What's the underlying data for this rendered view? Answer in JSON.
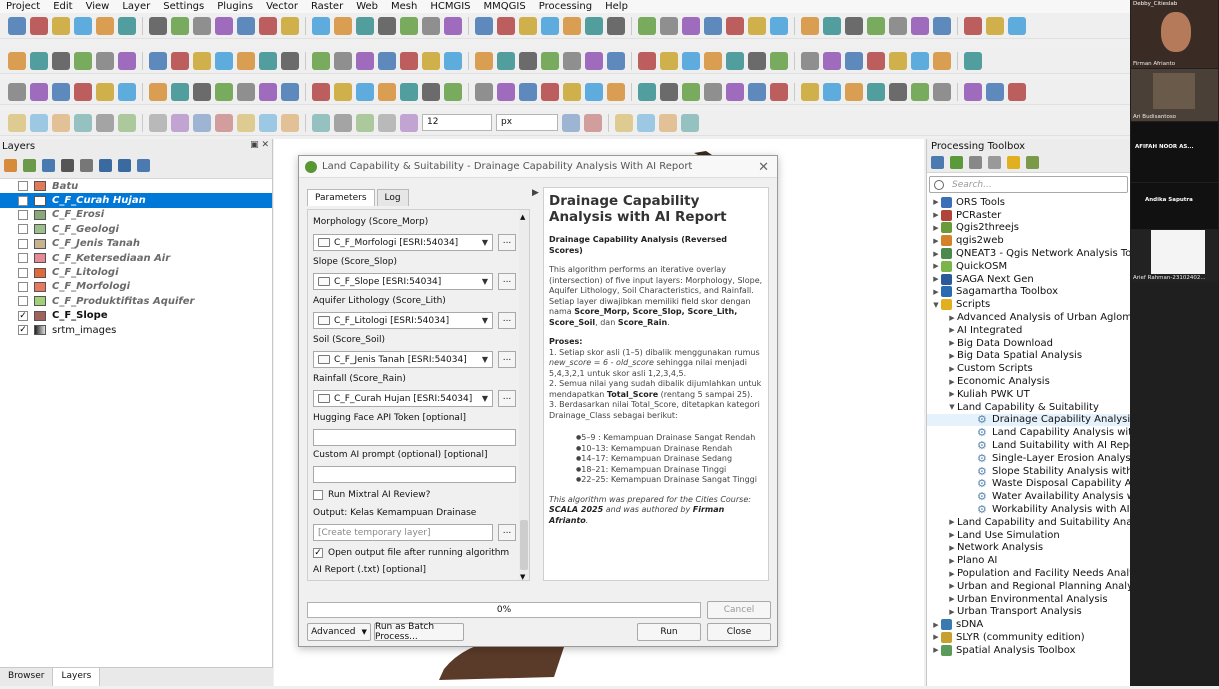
{
  "menu": [
    "Project",
    "Edit",
    "View",
    "Layer",
    "Settings",
    "Plugins",
    "Vector",
    "Raster",
    "Web",
    "Mesh",
    "HCMGIS",
    "MMQGIS",
    "Processing",
    "Help"
  ],
  "toolbar": {
    "size_value": "12",
    "unit_value": "px"
  },
  "layers_panel": {
    "title": "Layers",
    "items": [
      {
        "name": "Batu",
        "color": "#e27a5a",
        "checked": false
      },
      {
        "name": "C_F_Curah Hujan",
        "color": "#ffffff",
        "checked": false
      },
      {
        "name": "C_F_Erosi",
        "color": "#8aa87a",
        "checked": false
      },
      {
        "name": "C_F_Geologi",
        "color": "#9abf8a",
        "checked": false
      },
      {
        "name": "C_F_Jenis Tanah",
        "color": "#c7b48f",
        "checked": false
      },
      {
        "name": "C_F_Ketersediaan Air",
        "color": "#e88a95",
        "checked": false
      },
      {
        "name": "C_F_Litologi",
        "color": "#e2693a",
        "checked": false
      },
      {
        "name": "C_F_Morfologi",
        "color": "#e8785f",
        "checked": false
      },
      {
        "name": "C_F_Produktifitas Aquifer",
        "color": "#a4cf7a",
        "checked": false
      },
      {
        "name": "C_F_Slope",
        "color": "#a0625a",
        "checked": true
      },
      {
        "name": "srtm_images",
        "color": "",
        "checked": true
      }
    ],
    "bottom_tabs": [
      "Browser",
      "Layers"
    ]
  },
  "dialog": {
    "title": "Land Capability & Suitability - Drainage Capability Analysis With AI Report",
    "tabs": [
      "Parameters",
      "Log"
    ],
    "params": {
      "morph_label": "Morphology (Score_Morp)",
      "morph_value": "C_F_Morfologi [ESRI:54034]",
      "slope_label": "Slope (Score_Slop)",
      "slope_value": "C_F_Slope [ESRI:54034]",
      "lith_label": "Aquifer Lithology (Score_Lith)",
      "lith_value": "C_F_Litologi [ESRI:54034]",
      "soil_label": "Soil (Score_Soil)",
      "soil_value": "C_F_Jenis Tanah [ESRI:54034]",
      "rain_label": "Rainfall (Score_Rain)",
      "rain_value": "C_F_Curah Hujan [ESRI:54034]",
      "token_label": "Hugging Face API Token [optional]",
      "prompt_label": "Custom AI prompt (optional) [optional]",
      "mixtral_label": "Run Mixtral AI Review?",
      "output_label": "Output: Kelas Kemampuan Drainase",
      "output_placeholder": "[Create temporary layer]",
      "open_output_label": "Open output file after running algorithm",
      "report_label": "AI Report (.txt) [optional]",
      "dots": "..."
    },
    "help": {
      "title": "Drainage Capability Analysis with AI Report",
      "subtitle": "Drainage Capability Analysis (Reversed Scores)",
      "intro_a": "This algorithm performs an iterative overlay (intersection) of five input layers: Morphology, Slope, Aquifer Lithology, Soil Characteristics, and Rainfall. Setiap layer diwajibkan memiliki field skor dengan nama ",
      "intro_b": "Score_Morp, Score_Slop, Score_Lith, Score_Soil",
      "intro_c": ", dan ",
      "intro_d": "Score_Rain",
      "intro_e": ".",
      "proses": "Proses:",
      "p1a": "1. Setiap skor asli (1–5) dibalik menggunakan rumus ",
      "p1b": "new_score = 6 - old_score",
      "p1c": " sehingga nilai menjadi 5,4,3,2,1 untuk skor asli 1,2,3,4,5.",
      "p2a": "2. Semua nilai yang sudah dibalik dijumlahkan untuk mendapatkan ",
      "p2b": "Total_Score",
      "p2c": " (rentang 5 sampai 25).",
      "p3": "3. Berdasarkan nilai Total_Score, ditetapkan kategori Drainage_Class sebagai berikut:",
      "classes": [
        "5–9 : Kemampuan Drainase Sangat Rendah",
        "10–13: Kemampuan Drainase Rendah",
        "14–17: Kemampuan Drainase Sedang",
        "18–21: Kemampuan Drainase Tinggi",
        "22–25: Kemampuan Drainase Sangat Tinggi"
      ],
      "footer_a": "This algorithm was prepared for the Cities Course: ",
      "footer_b": "SCALA 2025",
      "footer_c": " and was authored by ",
      "footer_d": "Firman Afrianto",
      "footer_e": "."
    },
    "progress": "0%",
    "progress_fraction": 0,
    "cancel": "Cancel",
    "advanced": "Advanced",
    "batch": "Run as Batch Process...",
    "run": "Run",
    "close": "Close"
  },
  "toolbox": {
    "title": "Processing Toolbox",
    "search_placeholder": "Search...",
    "providers": [
      {
        "name": "ORS Tools",
        "color": "#3b6fb6"
      },
      {
        "name": "PCRaster",
        "color": "#b0443a"
      },
      {
        "name": "Qgis2threejs",
        "color": "#6a9a3a"
      },
      {
        "name": "qgis2web",
        "color": "#d4822a"
      },
      {
        "name": "QNEAT3 - Qgis Network Analysis Toolbox",
        "color": "#4c8a4c"
      },
      {
        "name": "QuickOSM",
        "color": "#7ab44a"
      },
      {
        "name": "SAGA Next Gen",
        "color": "#2a5a9a"
      },
      {
        "name": "Sagamartha Toolbox",
        "color": "#2a6ab0"
      }
    ],
    "scripts_label": "Scripts",
    "scripts_before": [
      "Advanced Analysis of Urban Aglomeration",
      "AI Integrated",
      "Big Data Download",
      "Big Data Spatial Analysis",
      "Custom Scripts",
      "Economic Analysis",
      "Kuliah PWK UT"
    ],
    "open_group": "Land Capability & Suitability",
    "open_items": [
      "Drainage Capability Analysis with AI Report",
      "Land Capability Analysis with AI Report",
      "Land Suitability with AI Report",
      "Single-Layer Erosion Analysis with AI Report",
      "Slope Stability Analysis with AI Report",
      "Waste Disposal Capability Analysis with AI Report",
      "Water Availability Analysis with AI Report",
      "Workability Analysis with AI Report"
    ],
    "scripts_after": [
      "Land Capability and Suitability Analysis",
      "Land Use Simulation",
      "Network Analysis",
      "Plano AI",
      "Population and Facility Needs Analysis",
      "Urban and Regional Planning Analysis",
      "Urban Environmental Analysis",
      "Urban Transport Analysis"
    ],
    "tail": [
      {
        "name": "sDNA",
        "color": "#3a7ab0"
      },
      {
        "name": "SLYR (community edition)",
        "color": "#c8a030"
      },
      {
        "name": "Spatial Analysis Toolbox",
        "color": "#5a9a5a"
      }
    ]
  },
  "participants": [
    "Debby_Citieslab",
    "Firman Afrianto",
    "Ari Budisantoso",
    "AFIFAH NOOR AS...",
    "Andika Saputra",
    "Arief Rahman-23102402..."
  ]
}
